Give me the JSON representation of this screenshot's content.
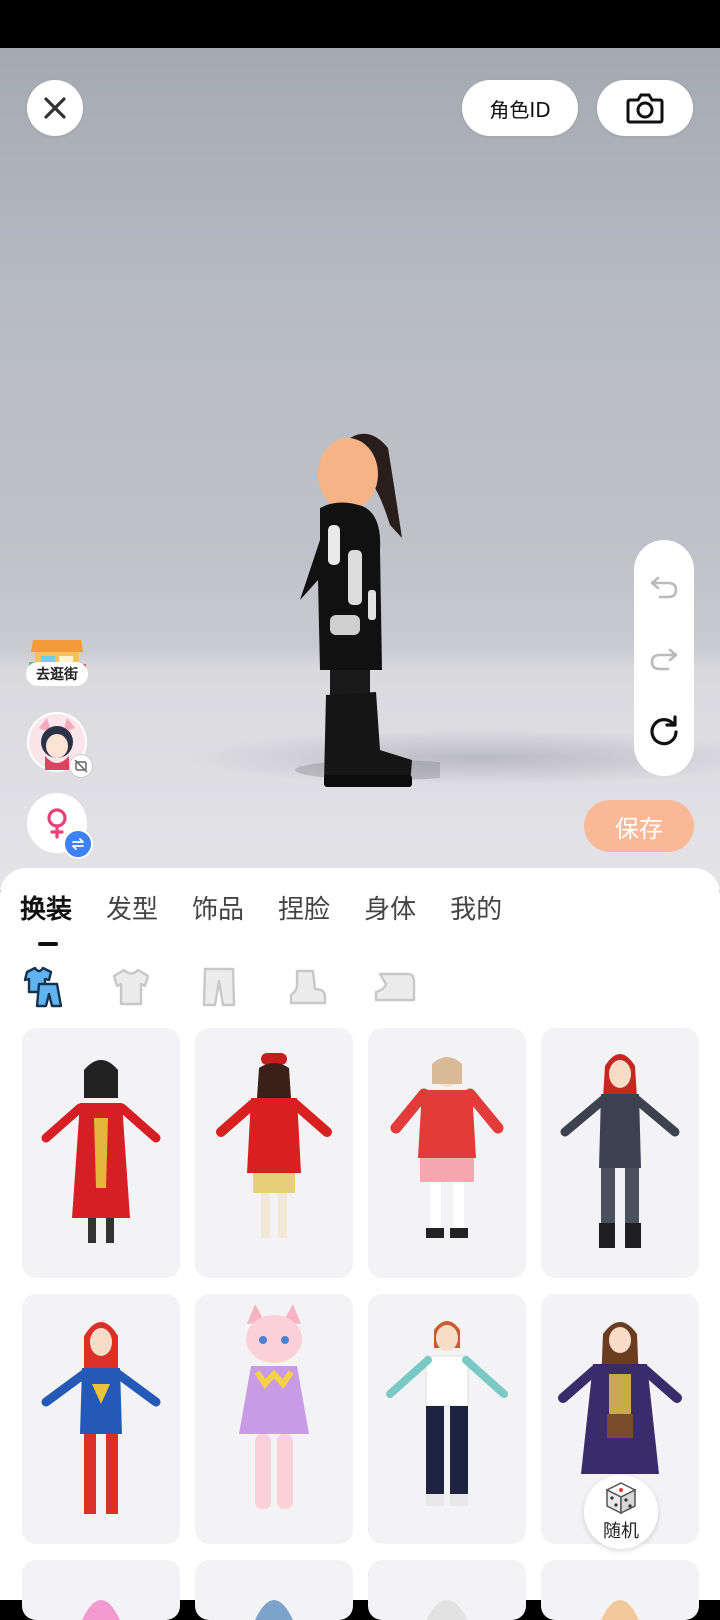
{
  "top": {
    "role_id_label": "角色ID"
  },
  "side": {
    "shop_label": "去逛街"
  },
  "actions": {
    "save_label": "保存",
    "random_label": "随机"
  },
  "tabs": [
    {
      "label": "换装",
      "active": true
    },
    {
      "label": "发型"
    },
    {
      "label": "饰品"
    },
    {
      "label": "捏脸"
    },
    {
      "label": "身体"
    },
    {
      "label": "我的"
    }
  ],
  "subtabs": [
    {
      "icon": "outfit-set-icon",
      "active": true
    },
    {
      "icon": "top-shirt-icon"
    },
    {
      "icon": "pants-icon"
    },
    {
      "icon": "socks-icon"
    },
    {
      "icon": "shoes-icon"
    }
  ],
  "outfits": [
    {
      "icon": "outfit-red-chinese-dress"
    },
    {
      "icon": "outfit-red-coat"
    },
    {
      "icon": "outfit-red-sweater-skirt"
    },
    {
      "icon": "outfit-black-bodysuit"
    },
    {
      "icon": "outfit-blue-red-superhero"
    },
    {
      "icon": "outfit-pink-cat-dress"
    },
    {
      "icon": "outfit-white-tee-track-pants"
    },
    {
      "icon": "outfit-purple-robe"
    }
  ],
  "colors": {
    "accent": "#f9b896",
    "badge": "#3b82f6",
    "gender": "#e8407a"
  }
}
